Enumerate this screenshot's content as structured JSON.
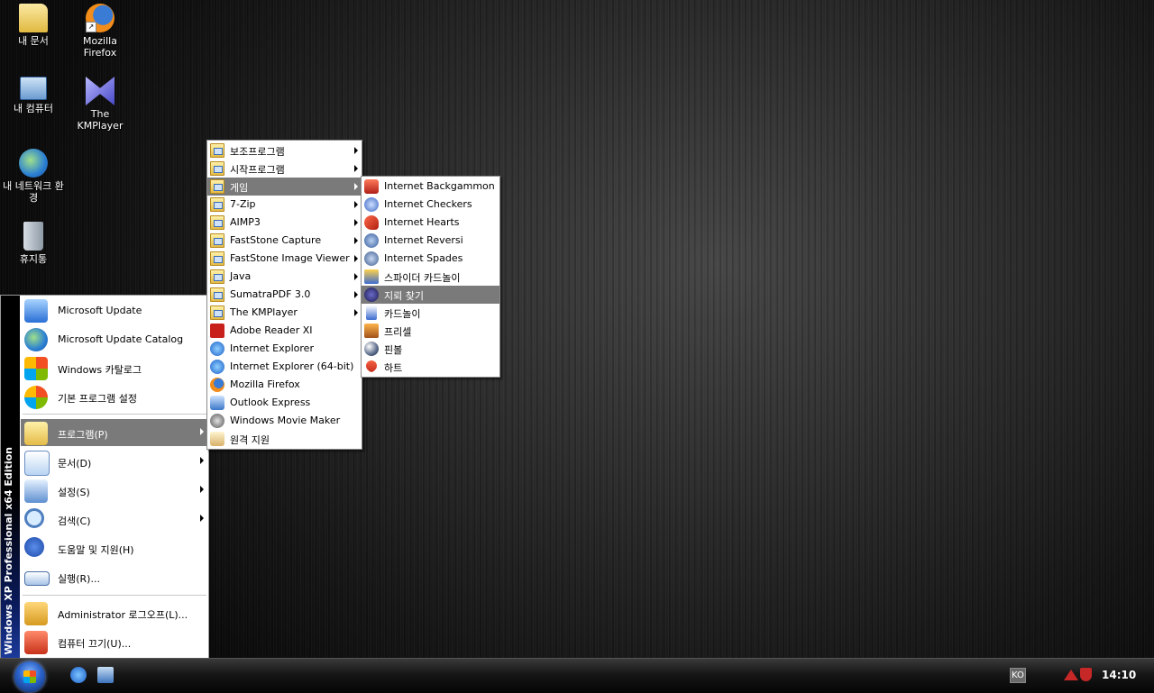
{
  "desktop": {
    "icons": [
      {
        "label": "내 문서",
        "icon": "folder-documents-icon"
      },
      {
        "label": "Mozilla Firefox",
        "icon": "firefox-icon"
      },
      {
        "label": "내 컴퓨터",
        "icon": "computer-icon"
      },
      {
        "label": "The KMPlayer",
        "icon": "kmplayer-icon"
      },
      {
        "label": "내 네트워크 환경",
        "icon": "network-icon"
      },
      {
        "label": "휴지통",
        "icon": "recycle-bin-icon"
      }
    ]
  },
  "start_menu": {
    "sidebar_text": "Windows XP Professional x64 Edition",
    "items": [
      {
        "label": "Microsoft Update",
        "icon": "microsoft-update-icon"
      },
      {
        "label": "Microsoft Update Catalog",
        "icon": "update-catalog-icon"
      },
      {
        "label": "Windows 카탈로그",
        "icon": "windows-catalog-icon"
      },
      {
        "label": "기본 프로그램 설정",
        "icon": "default-programs-icon"
      },
      {
        "label": "프로그램(P)",
        "icon": "programs-icon",
        "submenu": true,
        "highlighted": true
      },
      {
        "label": "문서(D)",
        "icon": "documents-icon",
        "submenu": true
      },
      {
        "label": "설정(S)",
        "icon": "settings-icon",
        "submenu": true
      },
      {
        "label": "검색(C)",
        "icon": "search-icon",
        "submenu": true
      },
      {
        "label": "도움말 및 지원(H)",
        "icon": "help-icon"
      },
      {
        "label": "실행(R)...",
        "icon": "run-icon"
      },
      {
        "label": "Administrator 로그오프(L)...",
        "icon": "logoff-icon"
      },
      {
        "label": "컴퓨터 끄기(U)...",
        "icon": "shutdown-icon"
      }
    ]
  },
  "programs_menu": {
    "items": [
      {
        "label": "보조프로그램",
        "folder": true
      },
      {
        "label": "시작프로그램",
        "folder": true
      },
      {
        "label": "게임",
        "folder": true,
        "highlighted": true
      },
      {
        "label": "7-Zip",
        "folder": true
      },
      {
        "label": "AIMP3",
        "folder": true
      },
      {
        "label": "FastStone Capture",
        "folder": true
      },
      {
        "label": "FastStone Image Viewer",
        "folder": true
      },
      {
        "label": "Java",
        "folder": true
      },
      {
        "label": "SumatraPDF 3.0",
        "folder": true
      },
      {
        "label": "The KMPlayer",
        "folder": true
      },
      {
        "label": "Adobe Reader XI",
        "icon": "adobe-reader-icon"
      },
      {
        "label": "Internet Explorer",
        "icon": "internet-explorer-icon"
      },
      {
        "label": "Internet Explorer (64-bit)",
        "icon": "internet-explorer-icon"
      },
      {
        "label": "Mozilla Firefox",
        "icon": "firefox-icon"
      },
      {
        "label": "Outlook Express",
        "icon": "outlook-express-icon"
      },
      {
        "label": "Windows Movie Maker",
        "icon": "movie-maker-icon"
      },
      {
        "label": "원격 지원",
        "icon": "remote-assistance-icon"
      }
    ]
  },
  "games_menu": {
    "items": [
      {
        "label": "Internet Backgammon",
        "icon": "backgammon-icon"
      },
      {
        "label": "Internet Checkers",
        "icon": "checkers-icon"
      },
      {
        "label": "Internet Hearts",
        "icon": "hearts-icon"
      },
      {
        "label": "Internet Reversi",
        "icon": "reversi-icon"
      },
      {
        "label": "Internet Spades",
        "icon": "spades-icon"
      },
      {
        "label": "스파이더 카드놀이",
        "icon": "spider-solitaire-icon"
      },
      {
        "label": "지뢰 찾기",
        "icon": "minesweeper-icon",
        "highlighted": true
      },
      {
        "label": "카드놀이",
        "icon": "solitaire-icon"
      },
      {
        "label": "프리셀",
        "icon": "freecell-icon"
      },
      {
        "label": "핀볼",
        "icon": "pinball-icon"
      },
      {
        "label": "하트",
        "icon": "hearts-game-icon"
      }
    ]
  },
  "taskbar": {
    "quick_launch": [
      "internet-explorer-icon",
      "show-desktop-icon"
    ],
    "language": "KO",
    "clock": "14:10"
  }
}
